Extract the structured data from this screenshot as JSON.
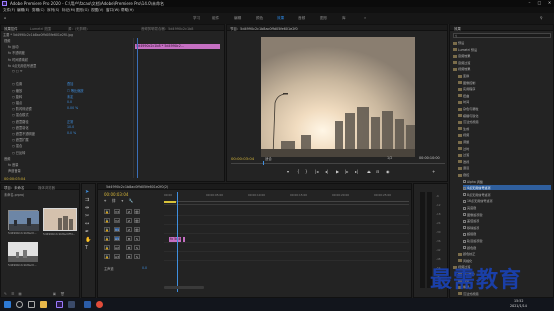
{
  "window": {
    "title": "Adobe Premiere Pro 2020 - C:\\用户\\fzcao\\文档\\Adobe\\Premiere Pro\\14.0\\未命名"
  },
  "menu": [
    "文件(F)",
    "编辑(E)",
    "剪辑(C)",
    "序列(S)",
    "标记(M)",
    "图形(G)",
    "视图(V)",
    "窗口(W)",
    "帮助(H)"
  ],
  "workspaces": [
    "学习",
    "组件",
    "编辑",
    "颜色",
    "效果",
    "音频",
    "图形",
    "库"
  ],
  "effect_controls": {
    "tabs": [
      "效果控件",
      "Lumetri 范围",
      "源：(无剪辑)",
      "音频剪辑混合器：5d4990c2c1b8"
    ],
    "master_label": "主要 * 5d4990c2c1b8ac0ffd05fe601e2f0.jpg",
    "clip_label": "5d4990c2c1b8 * 5d4990c2...",
    "rows": [
      {
        "label": "视频",
        "indent": 0
      },
      {
        "label": "fx  运动",
        "indent": 1
      },
      {
        "label": "fx  不透明度",
        "indent": 1
      },
      {
        "label": "fx  时间重映射",
        "indent": 1
      },
      {
        "label": "fx  4点无用信号遮罩",
        "indent": 1
      },
      {
        "label": "○ □ ✒",
        "indent": 2
      },
      {
        "label": "",
        "indent": 2
      },
      {
        "label": "○ 位置",
        "indent": 2,
        "value": "叠加"
      },
      {
        "label": "○ 缩放",
        "indent": 2,
        "value": "☐ 等比缩放"
      },
      {
        "label": "○ 旋转",
        "indent": 2,
        "value": "未定"
      },
      {
        "label": "○ 锚点",
        "indent": 2,
        "value": "0.0"
      },
      {
        "label": "○ 防闪烁滤镜",
        "indent": 2,
        "value": "0.00 %"
      },
      {
        "label": "○ 混合模式",
        "indent": 2
      },
      {
        "label": "○ 遮罩路径",
        "indent": 2,
        "value": "正常"
      },
      {
        "label": "○ 遮罩羽化",
        "indent": 2,
        "value": "10.0"
      },
      {
        "label": "○ 遮罩不透明度",
        "indent": 2,
        "value": "0.0 %"
      },
      {
        "label": "○ 遮罩扩展",
        "indent": 2
      },
      {
        "label": "○ 混合",
        "indent": 2
      },
      {
        "label": "○ 已反转",
        "indent": 2
      },
      {
        "label": "音频",
        "indent": 0
      },
      {
        "label": "fx  音量",
        "indent": 1
      },
      {
        "label": "声道音量",
        "indent": 1
      }
    ],
    "timecode": "00:00:03:04"
  },
  "program_monitor": {
    "title": "节目：5d4990c2c1b8ac0ffd05fe601e2f0",
    "timecode_left": "00:00:03:04",
    "fit_label": "适合",
    "quality": "完整",
    "timecode_right": "00:00:10:00",
    "ratio": "1/2"
  },
  "project": {
    "tabs": [
      "项目：未命名",
      "媒体浏览器"
    ],
    "name": "未命名.prproj",
    "items": [
      {
        "name": "5d4990c2c1b8ac0...",
        "duration": "5:00"
      },
      {
        "name": "5d4990c2c1b8ac0ffd...",
        "duration": "5:00"
      },
      {
        "name": "5d4990c2c1b8ac0...",
        "duration": "4:29"
      }
    ]
  },
  "timeline": {
    "tab": "5d4990c2c1b8ac0ffd05fe601e2f0(2)",
    "timecode": "00:00:03:04",
    "ruler": [
      "00:00",
      "00:00:05:00",
      "00:00:10:00",
      "00:00:15:00",
      "00:00:20:00",
      "00:00:25:00"
    ],
    "tracks": [
      "V3",
      "V2",
      "V1",
      "A1",
      "A2",
      "A3"
    ],
    "clip_label": "fx 5d4990c2",
    "master_label": "主声道",
    "master_value": "0.0"
  },
  "effects_panel": {
    "tab": "效果",
    "items": [
      {
        "label": "预设",
        "level": 0,
        "type": "folder"
      },
      {
        "label": "Lumetri 预设",
        "level": 0,
        "type": "folder"
      },
      {
        "label": "音频效果",
        "level": 0,
        "type": "folder"
      },
      {
        "label": "音频过渡",
        "level": 0,
        "type": "folder"
      },
      {
        "label": "视频效果",
        "level": 0,
        "type": "folder"
      },
      {
        "label": "变换",
        "level": 1,
        "type": "folder"
      },
      {
        "label": "图像控制",
        "level": 1,
        "type": "folder"
      },
      {
        "label": "实用程序",
        "level": 1,
        "type": "folder"
      },
      {
        "label": "扭曲",
        "level": 1,
        "type": "folder"
      },
      {
        "label": "时间",
        "level": 1,
        "type": "folder"
      },
      {
        "label": "杂色与颗粒",
        "level": 1,
        "type": "folder"
      },
      {
        "label": "模糊与锐化",
        "level": 1,
        "type": "folder"
      },
      {
        "label": "沉浸式视频",
        "level": 1,
        "type": "folder"
      },
      {
        "label": "生成",
        "level": 1,
        "type": "folder"
      },
      {
        "label": "视频",
        "level": 1,
        "type": "folder"
      },
      {
        "label": "调整",
        "level": 1,
        "type": "folder"
      },
      {
        "label": "过时",
        "level": 1,
        "type": "folder"
      },
      {
        "label": "过渡",
        "level": 1,
        "type": "folder"
      },
      {
        "label": "透视",
        "level": 1,
        "type": "folder"
      },
      {
        "label": "通道",
        "level": 1,
        "type": "folder"
      },
      {
        "label": "键控",
        "level": 1,
        "type": "folder"
      },
      {
        "label": "Alpha 调整",
        "level": 2,
        "type": "fx"
      },
      {
        "label": "4点无用信号遮罩",
        "level": 2,
        "type": "fx",
        "selected": true
      },
      {
        "label": "8点无用信号遮罩",
        "level": 2,
        "type": "fx"
      },
      {
        "label": "16点无用信号遮罩",
        "level": 2,
        "type": "fx"
      },
      {
        "label": "亮度键",
        "level": 2,
        "type": "fx"
      },
      {
        "label": "图像遮罩键",
        "level": 2,
        "type": "fx"
      },
      {
        "label": "差值遮罩",
        "level": 2,
        "type": "fx"
      },
      {
        "label": "移除遮罩",
        "level": 2,
        "type": "fx"
      },
      {
        "label": "超级键",
        "level": 2,
        "type": "fx"
      },
      {
        "label": "轨道遮罩键",
        "level": 2,
        "type": "fx"
      },
      {
        "label": "颜色键",
        "level": 2,
        "type": "fx"
      },
      {
        "label": "颜色校正",
        "level": 1,
        "type": "folder"
      },
      {
        "label": "风格化",
        "level": 1,
        "type": "folder"
      },
      {
        "label": "视频过渡",
        "level": 0,
        "type": "folder"
      },
      {
        "label": "3D 运动",
        "level": 1,
        "type": "folder"
      },
      {
        "label": "划像",
        "level": 1,
        "type": "folder"
      },
      {
        "label": "擦除",
        "level": 1,
        "type": "folder"
      },
      {
        "label": "沉浸式视频",
        "level": 1,
        "type": "folder"
      }
    ]
  },
  "watermark": "最需教育",
  "taskbar": {
    "time": "15:52",
    "date": "2021/1/14"
  },
  "colors": {
    "accent": "#2d8ceb",
    "clip": "#c56fc2",
    "timecode": "#d9b93a",
    "watermark": "#1a3fa8"
  }
}
